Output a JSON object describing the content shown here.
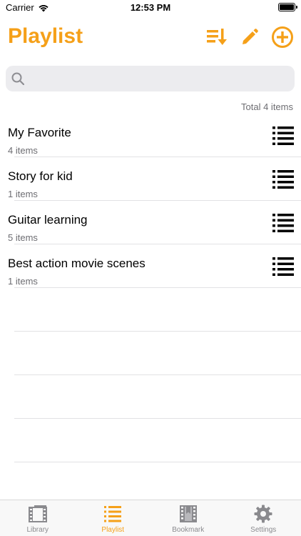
{
  "status_bar": {
    "carrier": "Carrier",
    "time": "12:53 PM"
  },
  "header": {
    "title": "Playlist",
    "accent_color": "#f5a019",
    "actions": [
      "sort-icon",
      "edit-icon",
      "add-icon"
    ]
  },
  "search": {
    "placeholder": "",
    "value": ""
  },
  "summary": {
    "total": "Total 4 items"
  },
  "playlists": [
    {
      "title": "My Favorite",
      "count": "4 items"
    },
    {
      "title": "Story for kid",
      "count": "1 items"
    },
    {
      "title": "Guitar learning",
      "count": "5 items"
    },
    {
      "title": "Best action movie scenes",
      "count": "1 items"
    }
  ],
  "tabs": [
    {
      "label": "Library",
      "icon": "library-icon",
      "active": false
    },
    {
      "label": "Playlist",
      "icon": "playlist-icon",
      "active": true
    },
    {
      "label": "Bookmark",
      "icon": "bookmark-icon",
      "active": false
    },
    {
      "label": "Settings",
      "icon": "settings-icon",
      "active": false
    }
  ]
}
